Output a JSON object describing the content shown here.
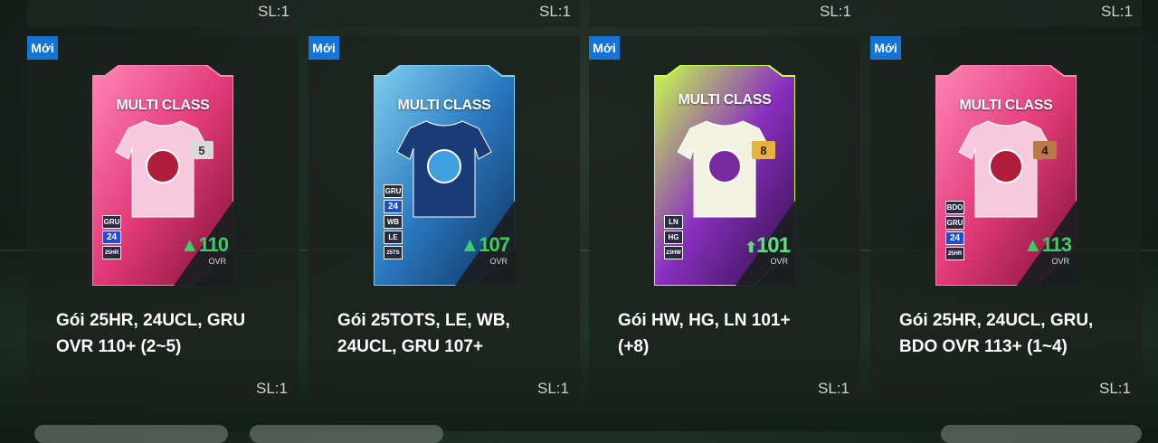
{
  "top_row": [
    {
      "sl": "SL:1"
    },
    {
      "sl": "SL:1"
    },
    {
      "sl": "SL:1"
    },
    {
      "sl": "SL:1"
    }
  ],
  "cards": [
    {
      "badge": "Mới",
      "pack_title": "MULTI CLASS",
      "level": "5",
      "tags": [
        "GRU",
        "24",
        "25HR"
      ],
      "ovr": "110",
      "ovr_label": "OVR",
      "name_line1": "Gói 25HR, 24UCL, GRU",
      "name_line2": "OVR 110+ (2~5)",
      "sl": "SL:1",
      "colors": {
        "main": "#e23a78",
        "dark": "#7a1034",
        "light": "#ff86b6"
      }
    },
    {
      "badge": "Mới",
      "pack_title": "MULTI CLASS",
      "level": "",
      "tags": [
        "GRU",
        "24",
        "WB",
        "LE",
        "25TS"
      ],
      "ovr": "107",
      "ovr_label": "OVR",
      "name_line1": "Gói 25TOTS, LE, WB,",
      "name_line2": "24UCL, GRU 107+",
      "sl": "SL:1",
      "colors": {
        "main": "#2a78c0",
        "dark": "#0f2f5c",
        "light": "#7fd0f0"
      }
    },
    {
      "badge": "Mới",
      "pack_title": "MULTI CLASS",
      "level": "8",
      "tags": [
        "LN",
        "HG",
        "23HW"
      ],
      "ovr": "101",
      "ovr_label": "OVR",
      "name_line1": "Gói HW, HG, LN 101+",
      "name_line2": "(+8)",
      "sl": "SL:1",
      "colors": {
        "main": "#8a2fc0",
        "dark": "#2a0f3e",
        "light": "#c8ff4a"
      }
    },
    {
      "badge": "Mới",
      "pack_title": "MULTI CLASS",
      "level": "4",
      "tags": [
        "BDO",
        "GRU",
        "24",
        "25HR"
      ],
      "ovr": "113",
      "ovr_label": "OVR",
      "name_line1": "Gói 25HR, 24UCL, GRU,",
      "name_line2": "BDO OVR 113+ (1~4)",
      "sl": "SL:1",
      "colors": {
        "main": "#e23a78",
        "dark": "#7a1034",
        "light": "#ff86b6"
      }
    }
  ]
}
